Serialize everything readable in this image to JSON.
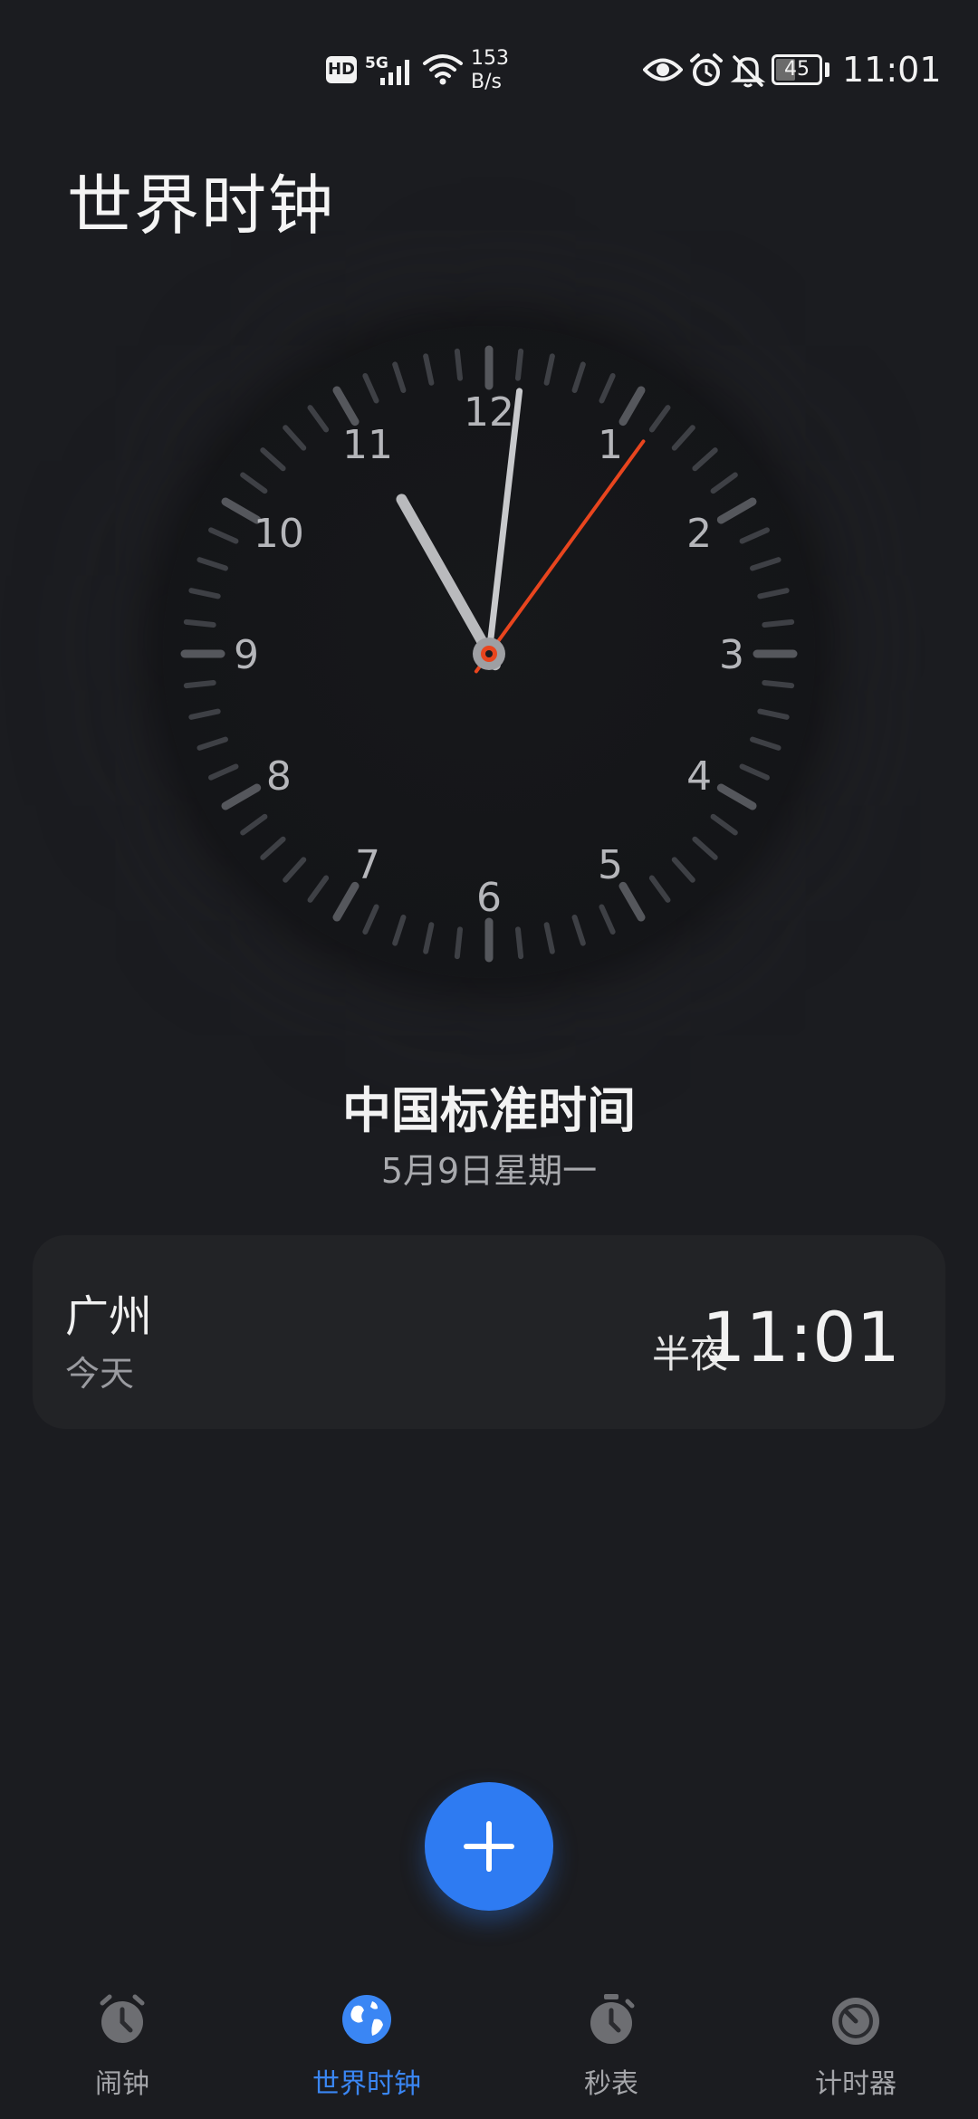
{
  "status_bar": {
    "hd": "HD",
    "network": "5G",
    "speed_value": "153",
    "speed_unit": "B/s",
    "battery": "45",
    "time": "11:01"
  },
  "page": {
    "title": "世界时钟"
  },
  "clock": {
    "numerals": [
      "12",
      "1",
      "2",
      "3",
      "4",
      "5",
      "6",
      "7",
      "8",
      "9",
      "10",
      "11"
    ],
    "time": {
      "hour": 11,
      "minute": 1,
      "second": 6
    },
    "second_hand_color": "#e8451e"
  },
  "standard_time": {
    "title": "中国标准时间",
    "date": "5月9日星期一"
  },
  "city": {
    "name": "广州",
    "day": "今天",
    "period": "半夜",
    "time": "11:01"
  },
  "fab": {
    "icon": "plus-icon"
  },
  "bottom_nav": {
    "items": [
      {
        "label": "闹钟",
        "icon": "alarm-clock-icon",
        "active": false
      },
      {
        "label": "世界时钟",
        "icon": "globe-icon",
        "active": true
      },
      {
        "label": "秒表",
        "icon": "stopwatch-icon",
        "active": false
      },
      {
        "label": "计时器",
        "icon": "timer-icon",
        "active": false
      }
    ]
  },
  "colors": {
    "accent": "#2e7bf2",
    "active_nav": "#3a86f4",
    "second_hand": "#e8451e",
    "background": "#1b1c20"
  }
}
